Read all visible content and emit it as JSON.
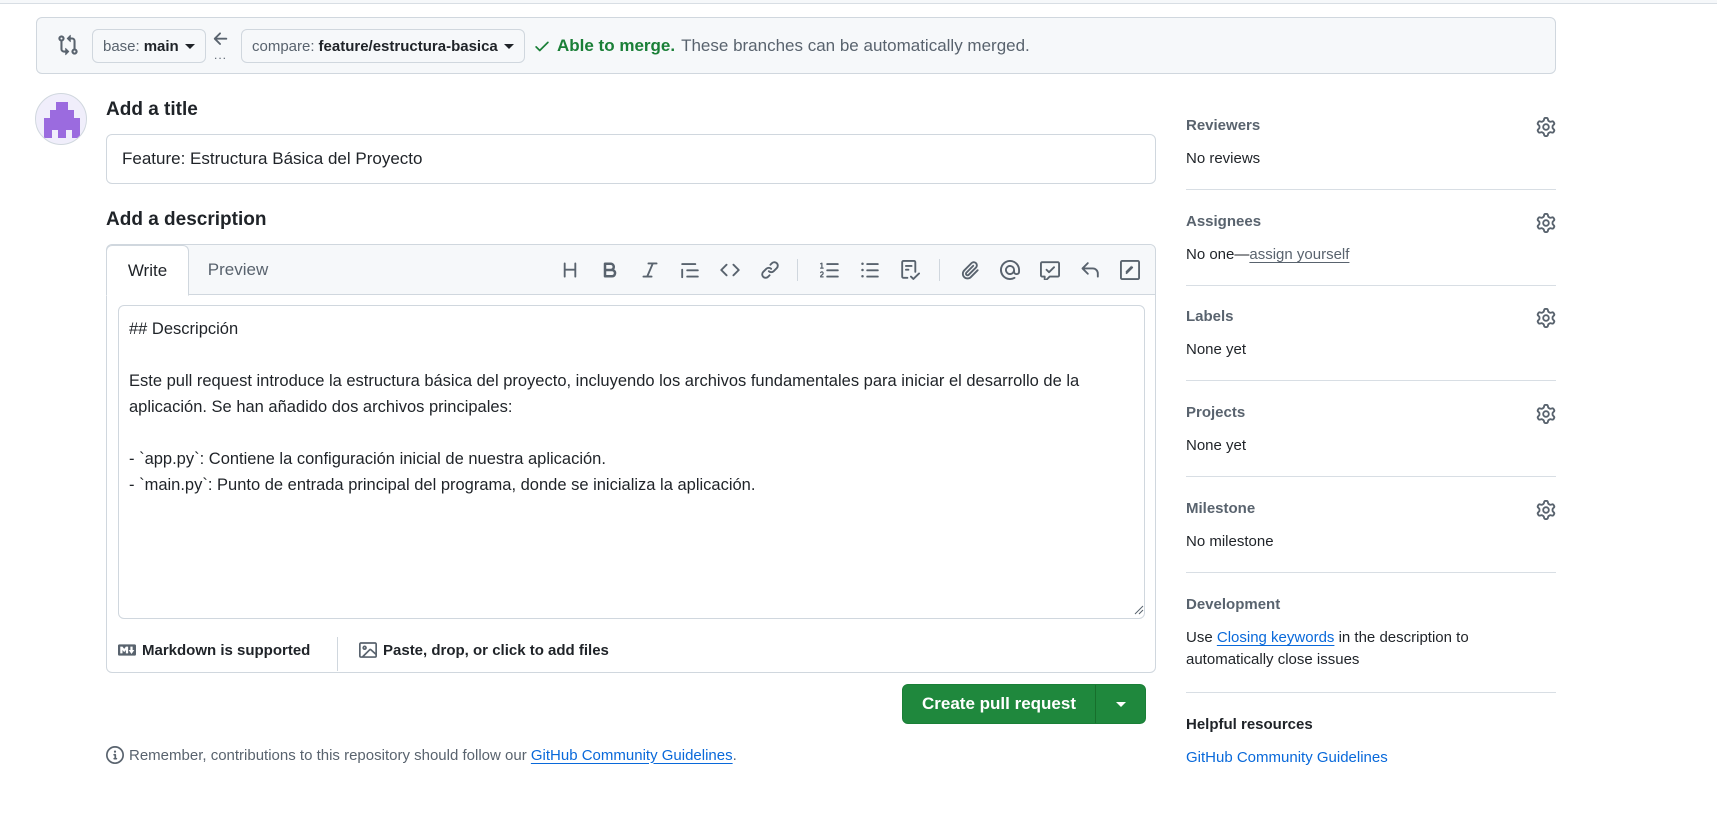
{
  "compare": {
    "base_label": "base:",
    "base_value": "main",
    "compare_label": "compare:",
    "compare_value": "feature/estructura-basica",
    "dots": "...",
    "status_ok": "Able to merge.",
    "status_msg": "These branches can be automatically merged."
  },
  "form": {
    "title_heading": "Add a title",
    "title_value": "Feature: Estructura Básica del Proyecto",
    "description_heading": "Add a description",
    "tabs": {
      "write": "Write",
      "preview": "Preview"
    },
    "toolbar_icons": [
      "heading-icon",
      "bold-icon",
      "italic-icon",
      "quote-icon",
      "code-icon",
      "link-icon",
      "ordered-list-icon",
      "unordered-list-icon",
      "task-list-icon",
      "attach-icon",
      "mention-icon",
      "reference-icon",
      "reply-icon",
      "slash-command-icon"
    ],
    "description_value": "## Descripción\n\nEste pull request introduce la estructura básica del proyecto, incluyendo los archivos fundamentales para iniciar el desarrollo de la aplicación. Se han añadido dos archivos principales:\n\n- `app.py`: Contiene la configuración inicial de nuestra aplicación.\n- `main.py`: Punto de entrada principal del programa, donde se inicializa la aplicación.",
    "markdown_note": "Markdown is supported",
    "files_note": "Paste, drop, or click to add files",
    "create_button": "Create pull request",
    "guidelines_prefix": "Remember, contributions to this repository should follow our",
    "guidelines_link": "GitHub Community Guidelines",
    "guidelines_suffix": "."
  },
  "sidebar": {
    "reviewers": {
      "title": "Reviewers",
      "value": "No reviews"
    },
    "assignees": {
      "title": "Assignees",
      "value_prefix": "No one—",
      "value_link": "assign yourself"
    },
    "labels": {
      "title": "Labels",
      "value": "None yet"
    },
    "projects": {
      "title": "Projects",
      "value": "None yet"
    },
    "milestone": {
      "title": "Milestone",
      "value": "No milestone"
    },
    "development": {
      "title": "Development",
      "prefix": "Use",
      "link": "Closing keywords",
      "suffix": "in the description to automatically close issues"
    },
    "helpful": {
      "title": "Helpful resources",
      "link": "GitHub Community Guidelines"
    }
  },
  "colors": {
    "success": "#1a7f37",
    "primary_button": "#1f883d",
    "link": "#0969da",
    "muted": "#59636e"
  }
}
